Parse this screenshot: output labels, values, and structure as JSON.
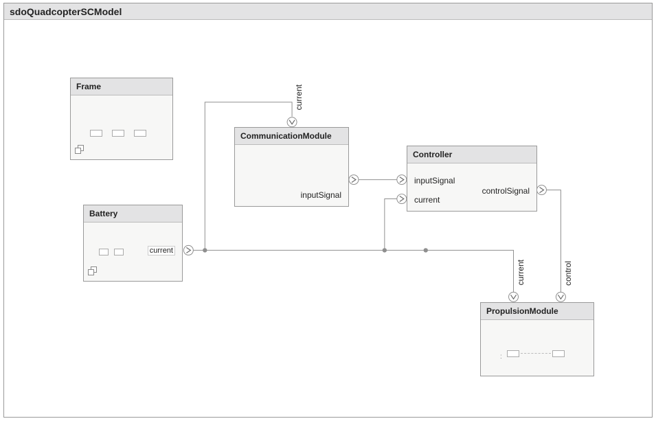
{
  "window": {
    "title": "sdoQuadcopterSCModel"
  },
  "blocks": {
    "frame": {
      "title": "Frame"
    },
    "battery": {
      "title": "Battery",
      "ports": {
        "current": "current"
      }
    },
    "comm": {
      "title": "CommunicationModule",
      "ports": {
        "current": "current",
        "inputSignal": "inputSignal"
      }
    },
    "controller": {
      "title": "Controller",
      "ports": {
        "inputSignal": "inputSignal",
        "current": "current",
        "controlSignal": "controlSignal"
      }
    },
    "propulsion": {
      "title": "PropulsionModule",
      "ports": {
        "current": "current",
        "control": "control"
      }
    }
  }
}
